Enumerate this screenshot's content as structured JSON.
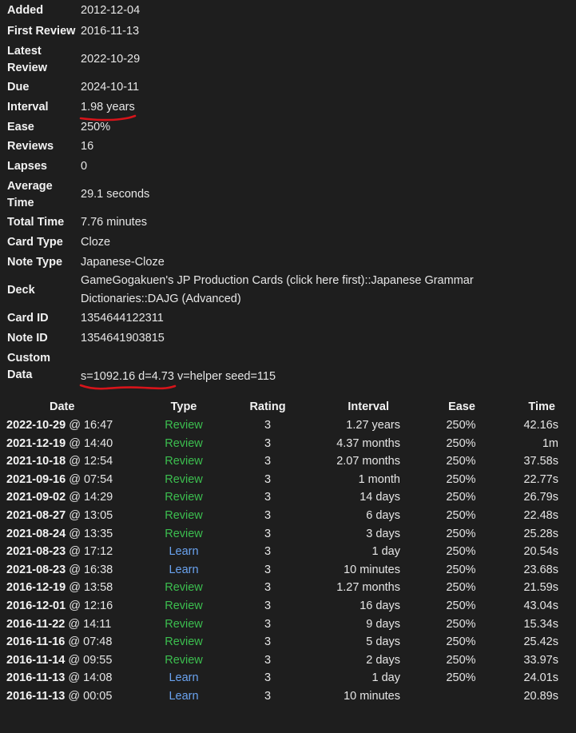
{
  "card_info": {
    "added": {
      "label": "Added",
      "value": "2012-12-04"
    },
    "first_review": {
      "label": "First Review",
      "value": "2016-11-13"
    },
    "latest_review": {
      "label_line1": "Latest",
      "label_line2": "Review",
      "value": "2022-10-29"
    },
    "due": {
      "label": "Due",
      "value": "2024-10-11"
    },
    "interval": {
      "label": "Interval",
      "value": "1.98 years"
    },
    "ease": {
      "label": "Ease",
      "value": "250%"
    },
    "reviews": {
      "label": "Reviews",
      "value": "16"
    },
    "lapses": {
      "label": "Lapses",
      "value": "0"
    },
    "average_time": {
      "label_line1": "Average",
      "label_line2": "Time",
      "value": "29.1 seconds"
    },
    "total_time": {
      "label": "Total Time",
      "value": "7.76 minutes"
    },
    "card_type": {
      "label": "Card Type",
      "value": "Cloze"
    },
    "note_type": {
      "label": "Note Type",
      "value": "Japanese-Cloze"
    },
    "deck": {
      "label": "Deck",
      "value_line1": "GameGogakuen's JP Production Cards (click here first)::Japanese Grammar",
      "value_line2": "Dictionaries::DAJG (Advanced)"
    },
    "card_id": {
      "label": "Card ID",
      "value": "1354644122311"
    },
    "note_id": {
      "label": "Note ID",
      "value": "1354641903815"
    },
    "custom_data": {
      "label_line1": "Custom",
      "label_line2": "Data",
      "value_marked": "s=1092.16 d=4.73",
      "value_rest": " v=helper seed=115"
    }
  },
  "annotation_color": "#d7141a",
  "history": {
    "headers": {
      "date": "Date",
      "type": "Type",
      "rating": "Rating",
      "interval": "Interval",
      "ease": "Ease",
      "time": "Time"
    },
    "type_colors": {
      "Review": "#3cbf4f",
      "Learn": "#6aa3f0"
    },
    "rows": [
      {
        "date": "2022-10-29",
        "at": " @ 16:47",
        "type": "Review",
        "rating": "3",
        "interval": "1.27 years",
        "ease": "250%",
        "time": "42.16s"
      },
      {
        "date": "2021-12-19",
        "at": " @ 14:40",
        "type": "Review",
        "rating": "3",
        "interval": "4.37 months",
        "ease": "250%",
        "time": "1m"
      },
      {
        "date": "2021-10-18",
        "at": " @ 12:54",
        "type": "Review",
        "rating": "3",
        "interval": "2.07 months",
        "ease": "250%",
        "time": "37.58s"
      },
      {
        "date": "2021-09-16",
        "at": " @ 07:54",
        "type": "Review",
        "rating": "3",
        "interval": "1 month",
        "ease": "250%",
        "time": "22.77s"
      },
      {
        "date": "2021-09-02",
        "at": " @ 14:29",
        "type": "Review",
        "rating": "3",
        "interval": "14 days",
        "ease": "250%",
        "time": "26.79s"
      },
      {
        "date": "2021-08-27",
        "at": " @ 13:05",
        "type": "Review",
        "rating": "3",
        "interval": "6 days",
        "ease": "250%",
        "time": "22.48s"
      },
      {
        "date": "2021-08-24",
        "at": " @ 13:35",
        "type": "Review",
        "rating": "3",
        "interval": "3 days",
        "ease": "250%",
        "time": "25.28s"
      },
      {
        "date": "2021-08-23",
        "at": " @ 17:12",
        "type": "Learn",
        "rating": "3",
        "interval": "1 day",
        "ease": "250%",
        "time": "20.54s"
      },
      {
        "date": "2021-08-23",
        "at": " @ 16:38",
        "type": "Learn",
        "rating": "3",
        "interval": "10 minutes",
        "ease": "250%",
        "time": "23.68s"
      },
      {
        "date": "2016-12-19",
        "at": " @ 13:58",
        "type": "Review",
        "rating": "3",
        "interval": "1.27 months",
        "ease": "250%",
        "time": "21.59s"
      },
      {
        "date": "2016-12-01",
        "at": " @ 12:16",
        "type": "Review",
        "rating": "3",
        "interval": "16 days",
        "ease": "250%",
        "time": "43.04s"
      },
      {
        "date": "2016-11-22",
        "at": " @ 14:11",
        "type": "Review",
        "rating": "3",
        "interval": "9 days",
        "ease": "250%",
        "time": "15.34s"
      },
      {
        "date": "2016-11-16",
        "at": " @ 07:48",
        "type": "Review",
        "rating": "3",
        "interval": "5 days",
        "ease": "250%",
        "time": "25.42s"
      },
      {
        "date": "2016-11-14",
        "at": " @ 09:55",
        "type": "Review",
        "rating": "3",
        "interval": "2 days",
        "ease": "250%",
        "time": "33.97s"
      },
      {
        "date": "2016-11-13",
        "at": " @ 14:08",
        "type": "Learn",
        "rating": "3",
        "interval": "1 day",
        "ease": "250%",
        "time": "24.01s"
      },
      {
        "date": "2016-11-13",
        "at": " @ 00:05",
        "type": "Learn",
        "rating": "3",
        "interval": "10 minutes",
        "ease": "",
        "time": "20.89s"
      }
    ]
  }
}
